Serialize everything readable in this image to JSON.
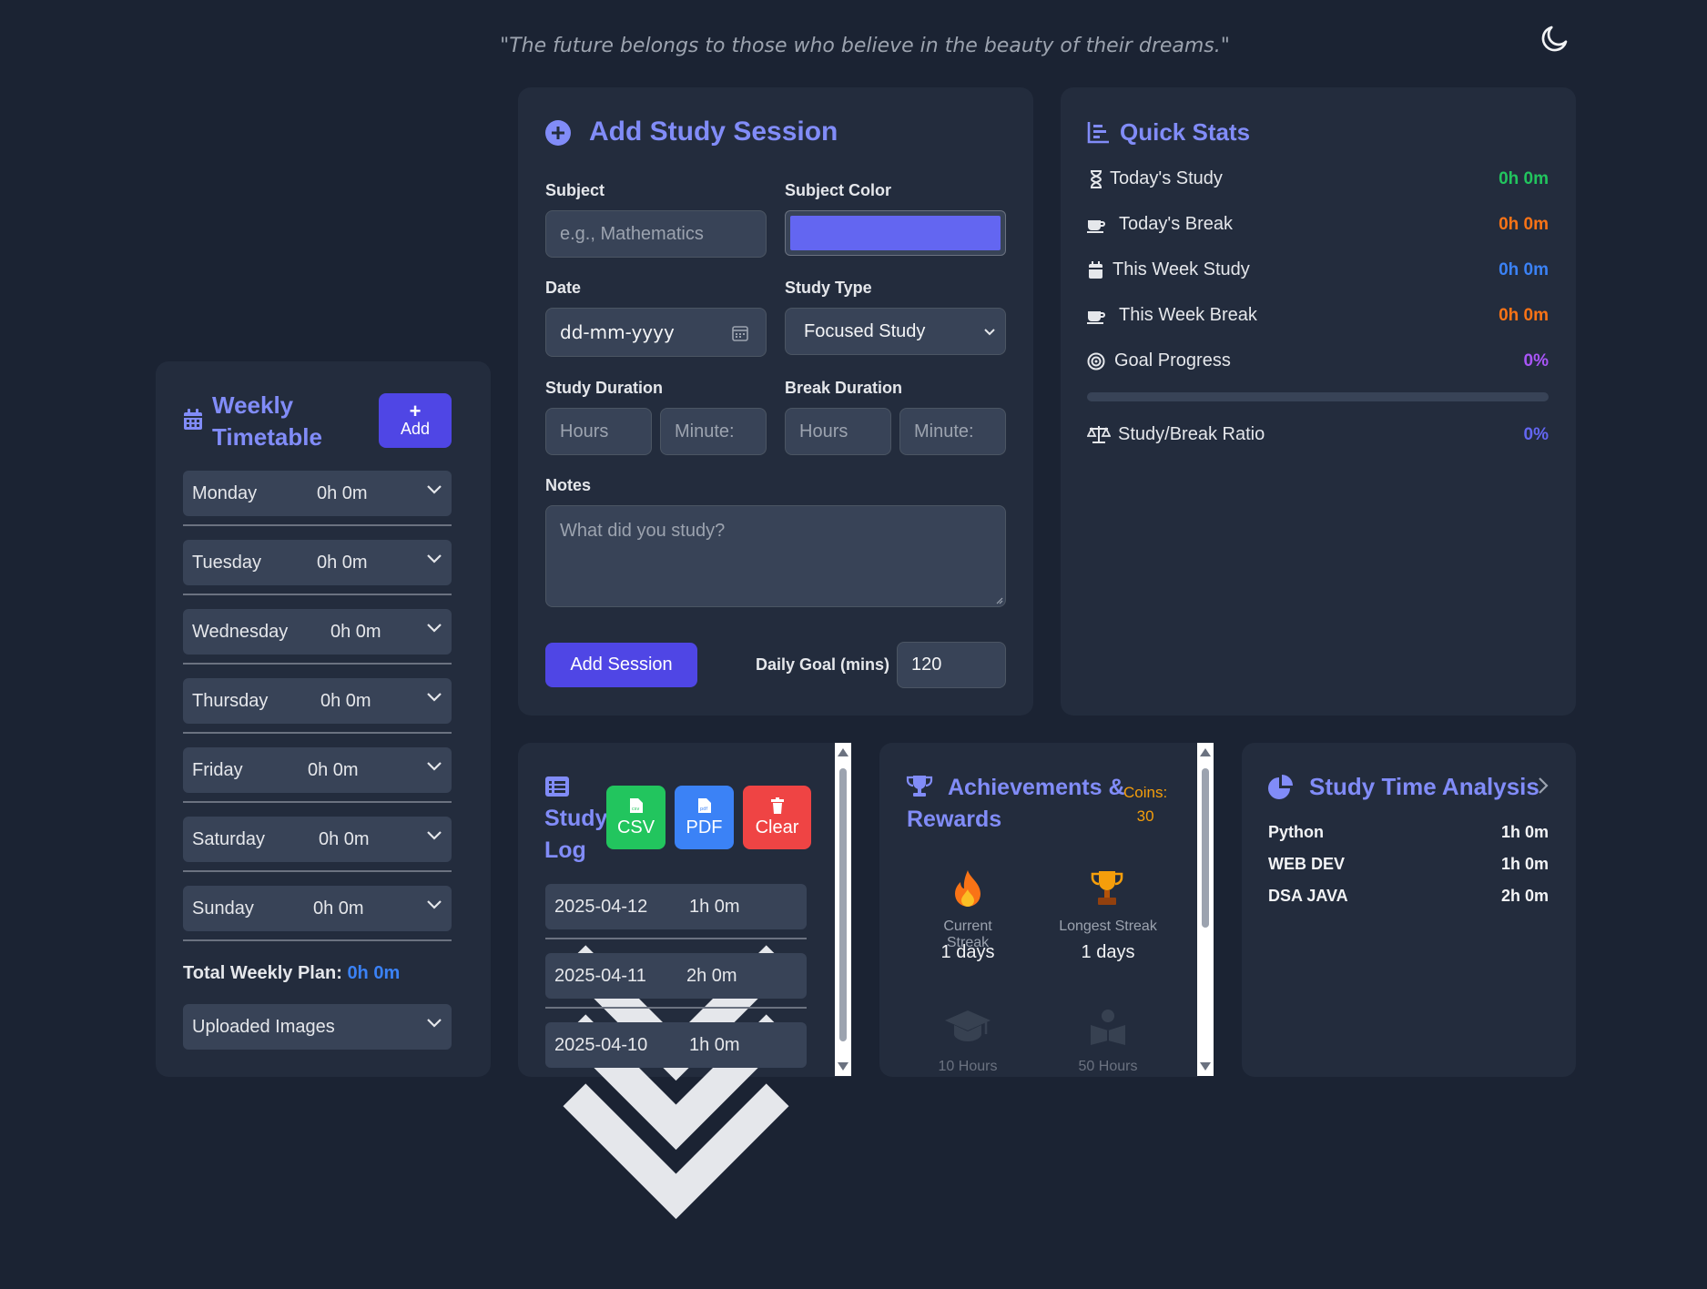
{
  "quote": "\"The future belongs to those who believe in the beauty of their dreams.\"",
  "theme_toggle_icon": "moon-icon",
  "timetable": {
    "title_line1": "Weekly",
    "title_line2": "Timetable",
    "add_label": "Add",
    "days": [
      {
        "name": "Monday",
        "time": "0h 0m"
      },
      {
        "name": "Tuesday",
        "time": "0h 0m"
      },
      {
        "name": "Wednesday",
        "time": "0h 0m"
      },
      {
        "name": "Thursday",
        "time": "0h 0m"
      },
      {
        "name": "Friday",
        "time": "0h 0m"
      },
      {
        "name": "Saturday",
        "time": "0h 0m"
      },
      {
        "name": "Sunday",
        "time": "0h 0m"
      }
    ],
    "total_label": "Total Weekly Plan:",
    "total_value": "0h 0m",
    "uploaded_images": "Uploaded Images"
  },
  "session": {
    "title": "Add Study Session",
    "subject_label": "Subject",
    "subject_placeholder": "e.g., Mathematics",
    "color_label": "Subject Color",
    "subject_color": "#6366f1",
    "date_label": "Date",
    "date_value": "dd-mm-yyyy",
    "type_label": "Study Type",
    "type_value": "Focused Study",
    "duration_label": "Study Duration",
    "break_label": "Break Duration",
    "hours_placeholder": "Hours",
    "minutes_placeholder": "Minute:",
    "notes_label": "Notes",
    "notes_placeholder": "What did you study?",
    "add_button": "Add Session",
    "goal_label": "Daily Goal (mins)",
    "goal_value": "120"
  },
  "stats": {
    "title": "Quick Stats",
    "items": [
      {
        "label": "Today's Study",
        "value": "0h 0m",
        "color": "#22c55e",
        "icon": "hourglass-icon"
      },
      {
        "label": "Today's Break",
        "value": "0h 0m",
        "color": "#f97316",
        "icon": "coffee-icon"
      },
      {
        "label": "This Week Study",
        "value": "0h 0m",
        "color": "#3b82f6",
        "icon": "calendar-icon"
      },
      {
        "label": "This Week Break",
        "value": "0h 0m",
        "color": "#f97316",
        "icon": "coffee-icon"
      },
      {
        "label": "Goal Progress",
        "value": "0%",
        "color": "#a855f7",
        "icon": "target-icon"
      }
    ],
    "goal_progress": 0,
    "ratio_label": "Study/Break Ratio",
    "ratio_value": "0%",
    "ratio_color": "#6366f1"
  },
  "log": {
    "title_line1": "Study",
    "title_line2": "Log",
    "csv_label": "CSV",
    "pdf_label": "PDF",
    "clear_label": "Clear",
    "entries": [
      {
        "date": "2025-04-12",
        "time": "1h 0m"
      },
      {
        "date": "2025-04-11",
        "time": "2h 0m"
      },
      {
        "date": "2025-04-10",
        "time": "1h 0m"
      }
    ]
  },
  "achievements": {
    "title_line1": "Achievements &",
    "title_line2": "Rewards",
    "coins_label": "Coins:",
    "coins_value": "30",
    "current_streak_label": "Current Streak",
    "current_streak_value": "1 days",
    "longest_streak_label": "Longest Streak",
    "longest_streak_value": "1 days",
    "badge1_label": "10 Hours",
    "badge2_label": "50 Hours"
  },
  "analysis": {
    "title": "Study Time Analysis",
    "rows": [
      {
        "subject": "Python",
        "time": "1h 0m"
      },
      {
        "subject": "WEB DEV",
        "time": "1h 0m"
      },
      {
        "subject": "DSA JAVA",
        "time": "2h 0m"
      }
    ]
  },
  "colors": {
    "accent": "#6366f1",
    "accent_text": "#818cf8",
    "background": "#1b2333",
    "card": "#232c3d",
    "csv": "#22c55e",
    "pdf": "#3b82f6",
    "clear": "#ef4444",
    "coins": "#f59e0b"
  }
}
